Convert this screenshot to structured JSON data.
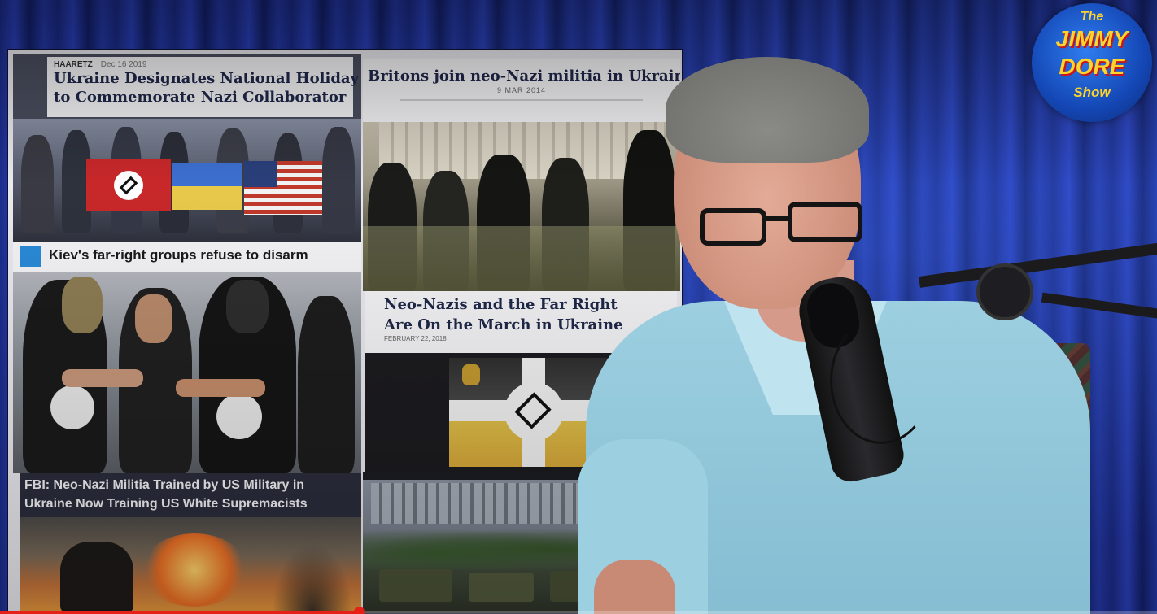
{
  "logo": {
    "line1": "The",
    "line2": "JIMMY",
    "line3": "DORE",
    "line4": "Show"
  },
  "collage": {
    "panel1": {
      "source": "HAARETZ",
      "date": "Dec 16 2019",
      "headline_line1": "Ukraine Designates National Holiday",
      "headline_line2": "to Commemorate Nazi Collaborator"
    },
    "panel2": {
      "headline": "Britons join neo-Nazi militia in Ukraine",
      "date": "9 MAR 2014"
    },
    "panel3": {
      "headline": "Kiev's far-right groups refuse to disarm"
    },
    "panel4": {
      "headline_line1": "Neo-Nazis and the Far Right",
      "headline_line2": "Are On the March in Ukraine",
      "date": "FEBRUARY 22, 2018"
    },
    "panel5": {
      "headline_line1": "FBI: Neo-Nazi Militia Trained by US Military in",
      "headline_line2": "Ukraine Now Training US White Supremacists"
    }
  },
  "video": {
    "progress_fraction": 0.31
  }
}
